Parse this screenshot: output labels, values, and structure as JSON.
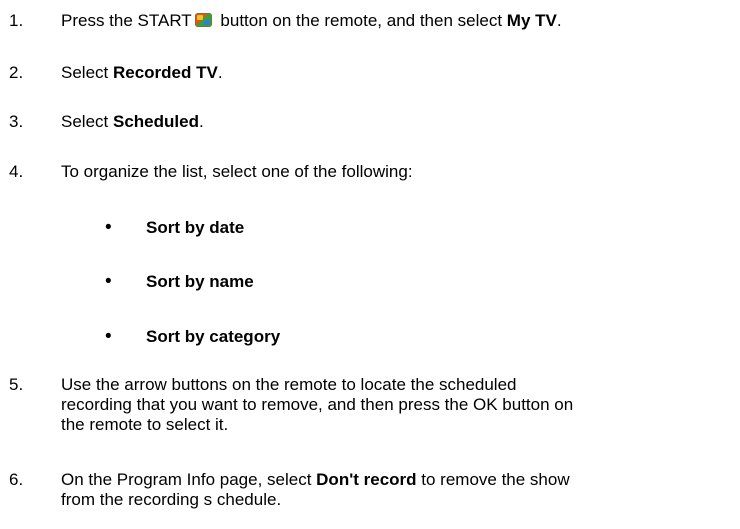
{
  "steps": [
    {
      "num": "1.",
      "pre": "Press the START",
      "mid": " button on the remote, and then select ",
      "bold": "My TV",
      "post": "."
    },
    {
      "num": "2.",
      "pre": "Select ",
      "bold": "Recorded TV",
      "post": "."
    },
    {
      "num": "3.",
      "pre": "Select ",
      "bold": "Scheduled",
      "post": "."
    },
    {
      "num": "4.",
      "text": "To organize the list, select one of the following:"
    },
    {
      "num": "5.",
      "line1": "Use the arrow buttons on the remote to locate the scheduled",
      "line2": "recording that you want to remove, and then press the OK button on",
      "line3": "the remote to select it."
    },
    {
      "num": "6.",
      "pre": "On the Program Info page, select ",
      "bold": "Don't record",
      "post": " to remove the show",
      "line2": "from the recording s chedule."
    }
  ],
  "bullets": [
    "Sort by date",
    "Sort by name",
    "Sort by category"
  ],
  "bullet_symbol": "•",
  "icons": {
    "start_button": "windows-start-icon"
  }
}
